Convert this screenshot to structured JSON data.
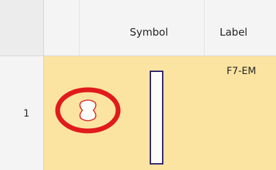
{
  "table": {
    "columns": [
      "",
      "Symbol",
      "Label"
    ],
    "rows": [
      {
        "row_number": "1",
        "label": "F7-EM",
        "symbol_icon": "vertical-rectangle-symbol"
      }
    ]
  },
  "annotation": {
    "color": "#e01b1b",
    "icon": "red-circle-highlight"
  },
  "colors": {
    "row_fill": "#fbe3a1",
    "header_fill": "#f4f4f4",
    "symbol_border": "#2a1f6e"
  }
}
